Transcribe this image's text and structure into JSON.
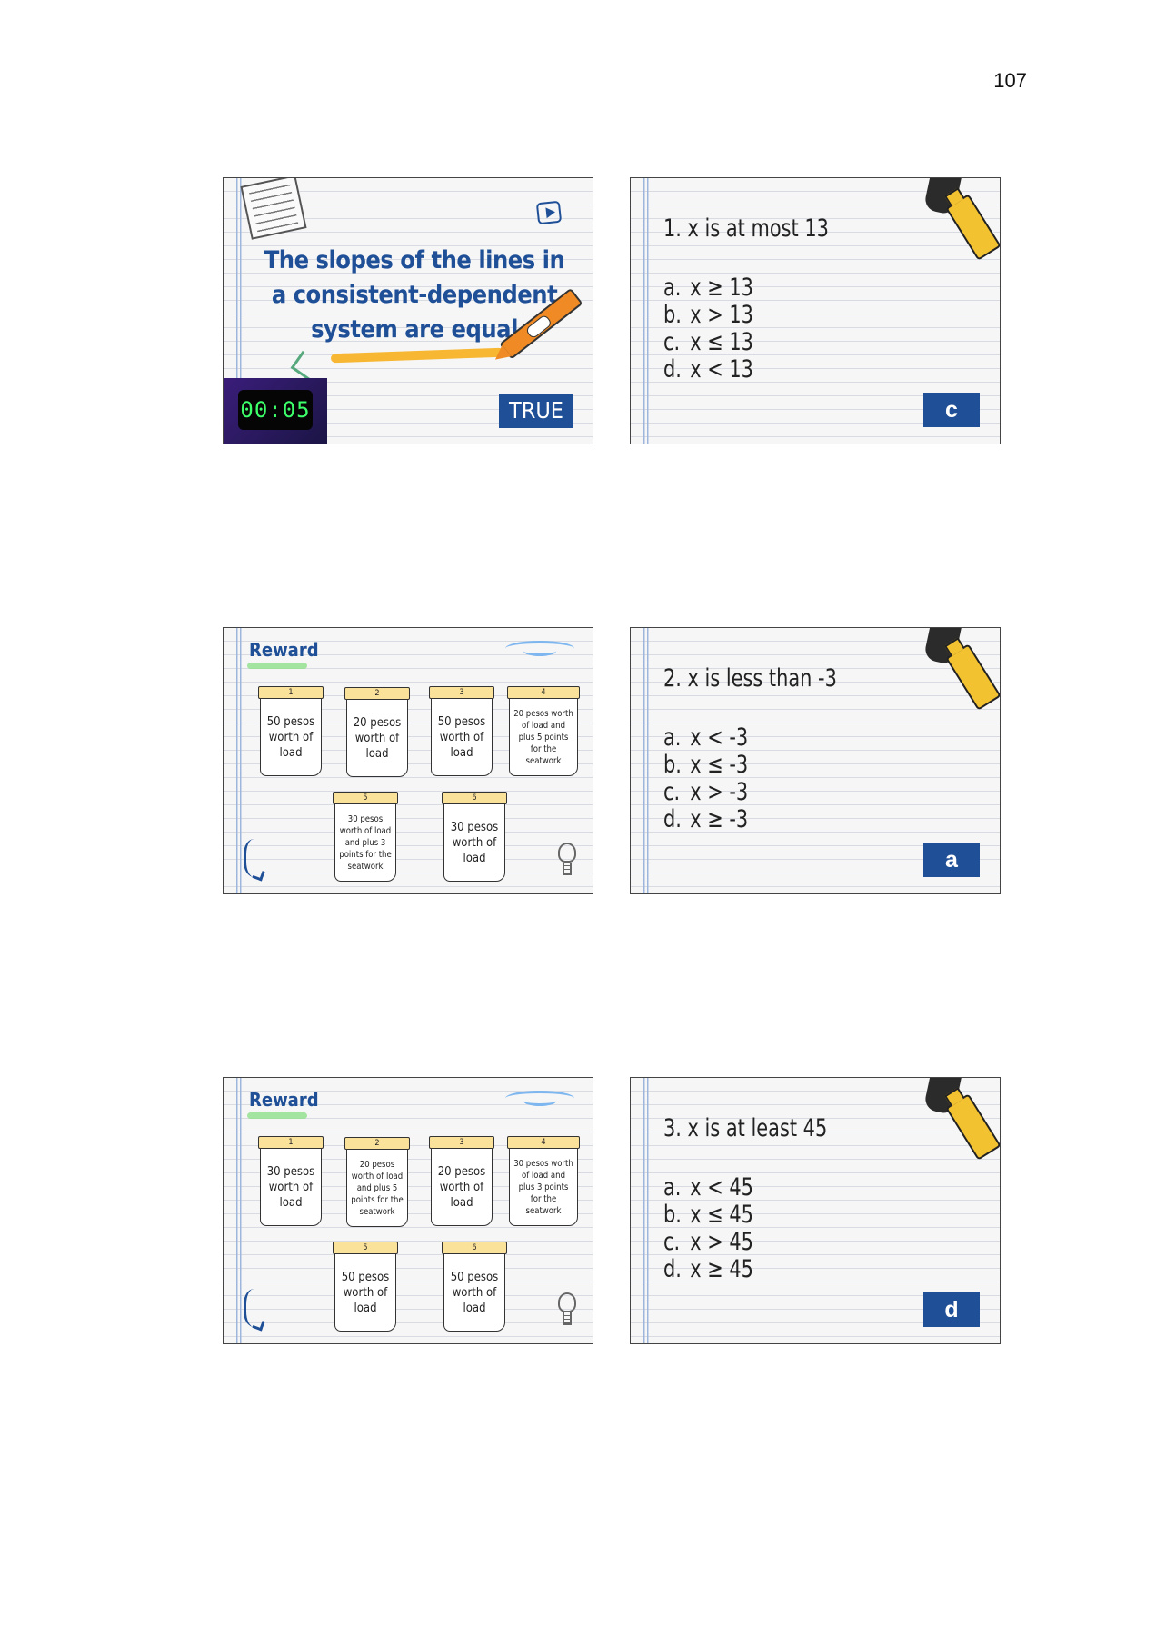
{
  "page_number": "107",
  "slide_true_false": {
    "statement": "The slopes of the lines in a consistent-dependent system are equal",
    "timer": "00:05",
    "answer": "TRUE"
  },
  "question_slides": [
    {
      "question": "1. x is at most 13",
      "options": [
        {
          "letter": "a.",
          "text": "x ≥ 13"
        },
        {
          "letter": "b.",
          "text": "x > 13"
        },
        {
          "letter": "c.",
          "text": "x ≤ 13"
        },
        {
          "letter": "d.",
          "text": "x < 13"
        }
      ],
      "answer": "c"
    },
    {
      "question": "2. x is less than -3",
      "options": [
        {
          "letter": "a.",
          "text": "x < -3"
        },
        {
          "letter": "b.",
          "text": "x ≤ -3"
        },
        {
          "letter": "c.",
          "text": "x > -3"
        },
        {
          "letter": "d.",
          "text": "x ≥ -3"
        }
      ],
      "answer": "a"
    },
    {
      "question": "3. x is at least 45",
      "options": [
        {
          "letter": "a.",
          "text": "x < 45"
        },
        {
          "letter": "b.",
          "text": "x ≤ 45"
        },
        {
          "letter": "c.",
          "text": "x > 45"
        },
        {
          "letter": "d.",
          "text": "x ≥ 45"
        }
      ],
      "answer": "d"
    }
  ],
  "reward_slides": [
    {
      "title": "Reward",
      "cards": [
        {
          "number": "1",
          "text": "50 pesos worth of load"
        },
        {
          "number": "2",
          "text": "20 pesos worth of load"
        },
        {
          "number": "3",
          "text": "50 pesos worth of load"
        },
        {
          "number": "4",
          "text": "20 pesos worth of load and plus 5 points for the seatwork"
        },
        {
          "number": "5",
          "text": "30 pesos worth of load and plus 3 points for the seatwork"
        },
        {
          "number": "6",
          "text": "30 pesos worth of load"
        }
      ]
    },
    {
      "title": "Reward",
      "cards": [
        {
          "number": "1",
          "text": "30 pesos worth of load"
        },
        {
          "number": "2",
          "text": "20 pesos worth of load and plus 5 points for the seatwork"
        },
        {
          "number": "3",
          "text": "20 pesos worth of load"
        },
        {
          "number": "4",
          "text": "30 pesos worth of load and plus 3 points for the seatwork"
        },
        {
          "number": "5",
          "text": "50 pesos worth of load"
        },
        {
          "number": "6",
          "text": "50 pesos worth of load"
        }
      ]
    }
  ]
}
